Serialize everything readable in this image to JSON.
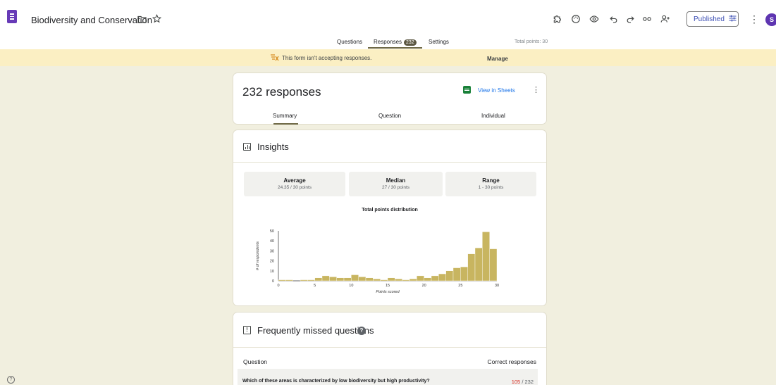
{
  "header": {
    "form_title": "Biodiversity and Conservation",
    "published_label": "Published",
    "avatar_letter": "S"
  },
  "tabs": {
    "questions": "Questions",
    "responses": "Responses",
    "responses_count": "232",
    "settings": "Settings",
    "total_points": "Total points: 30"
  },
  "banner": {
    "text": "This form isn't accepting responses.",
    "action": "Manage"
  },
  "responses_card": {
    "title": "232 responses",
    "view_in_sheets": "View in Sheets",
    "subtabs": [
      "Summary",
      "Question",
      "Individual"
    ]
  },
  "insights": {
    "title": "Insights",
    "stats": [
      {
        "label": "Average",
        "value": "24.35 / 30 points"
      },
      {
        "label": "Median",
        "value": "27 / 30 points"
      },
      {
        "label": "Range",
        "value": "1 - 30 points"
      }
    ]
  },
  "chart_data": {
    "type": "bar",
    "title": "Total points distribution",
    "xlabel": "Points scored",
    "ylabel": "# of respondents",
    "x": [
      1,
      2,
      3,
      4,
      5,
      6,
      7,
      8,
      9,
      10,
      11,
      12,
      13,
      14,
      15,
      16,
      17,
      18,
      19,
      20,
      21,
      22,
      23,
      24,
      25,
      26,
      27,
      28,
      29,
      30
    ],
    "values": [
      1,
      1,
      0,
      1,
      1,
      3,
      5,
      4,
      3,
      3,
      6,
      4,
      3,
      2,
      1,
      3,
      2,
      1,
      2,
      5,
      3,
      5,
      7,
      10,
      13,
      14,
      27,
      33,
      49,
      32
    ],
    "xticks": [
      0,
      5,
      10,
      15,
      20,
      25,
      30
    ],
    "yticks": [
      0,
      10,
      20,
      30,
      40,
      50
    ],
    "xlim": [
      0,
      30
    ],
    "ylim": [
      0,
      50
    ],
    "bar_color": "#c8b560"
  },
  "missed": {
    "title": "Frequently missed questions",
    "col_question": "Question",
    "col_correct": "Correct responses",
    "rows": [
      {
        "question": "Which of these areas is characterized by low biodiversity but high productivity?",
        "correct": "105",
        "total": "/ 232"
      }
    ]
  }
}
